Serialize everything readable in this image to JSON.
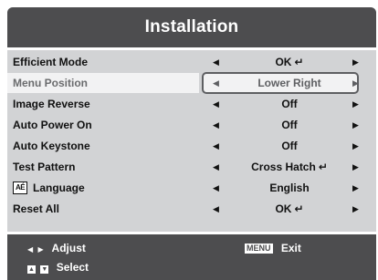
{
  "title": "Installation",
  "items": [
    {
      "label": "Efficient Mode",
      "value": "OK",
      "enter": true
    },
    {
      "label": "Menu Position",
      "value": "Lower Right",
      "enter": false,
      "selected": true
    },
    {
      "label": "Image Reverse",
      "value": "Off",
      "enter": false
    },
    {
      "label": "Auto Power On",
      "value": "Off",
      "enter": false
    },
    {
      "label": "Auto Keystone",
      "value": "Off",
      "enter": false
    },
    {
      "label": "Test Pattern",
      "value": "Cross Hatch",
      "enter": true
    },
    {
      "label": "Language",
      "value": "English",
      "enter": false,
      "icon": "language-icon",
      "icon_text": "AÉ"
    },
    {
      "label": "Reset All",
      "value": "OK",
      "enter": true
    }
  ],
  "footer": {
    "adjust_label": "Adjust",
    "select_label": "Select",
    "menu_key": "MENU",
    "exit_label": "Exit"
  },
  "glyphs": {
    "left": "◀",
    "right": "▶",
    "enter": "↵",
    "up": "▲",
    "down": "▼"
  },
  "colors": {
    "header": "#4d4d4f",
    "panel": "#d2d3d5",
    "selection_border": "#5e5f62",
    "text": "#111111"
  }
}
